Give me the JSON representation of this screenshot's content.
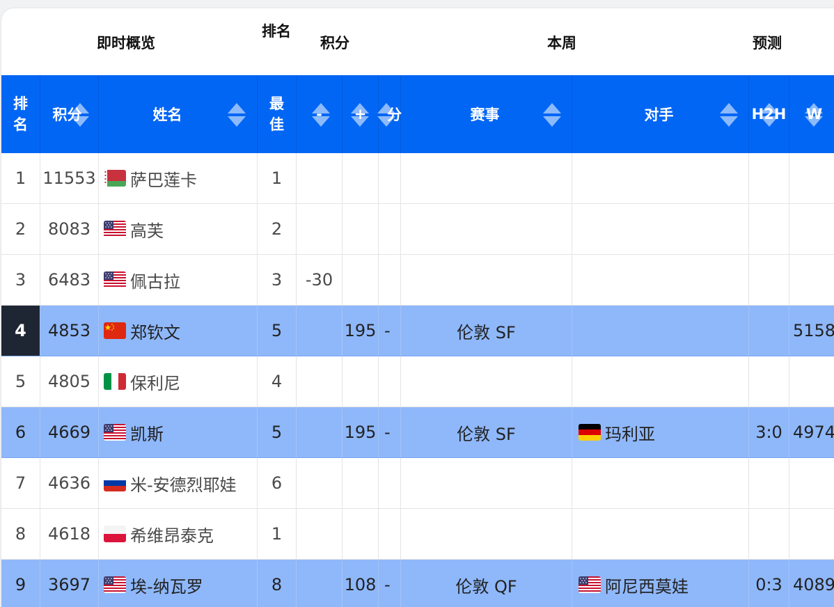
{
  "group_header": {
    "overview": "即时概览",
    "rank": "排名",
    "points": "积分",
    "this_week": "本周",
    "forecast": "预测"
  },
  "column_header": {
    "rank": "排名",
    "points": "积分",
    "name": "姓名",
    "best": "最佳",
    "minus": "-",
    "plus": "+",
    "pts": "分",
    "event": "赛事",
    "opponent": "对手",
    "h2h": "H2H",
    "w": "W"
  },
  "rows": [
    {
      "rank": "1",
      "points": "11553",
      "flag": "belarus-flag",
      "name": "萨巴莲卡",
      "best": "1",
      "minus": "",
      "plus": "",
      "pts": "",
      "event": "",
      "opp_flag": "",
      "opponent": "",
      "h2h": "",
      "w": "",
      "highlight": false
    },
    {
      "rank": "2",
      "points": "8083",
      "flag": "usa-flag",
      "name": "高芙",
      "best": "2",
      "minus": "",
      "plus": "",
      "pts": "",
      "event": "",
      "opp_flag": "",
      "opponent": "",
      "h2h": "",
      "w": "",
      "highlight": false
    },
    {
      "rank": "3",
      "points": "6483",
      "flag": "usa-flag",
      "name": "佩古拉",
      "best": "3",
      "minus": "-30",
      "plus": "",
      "pts": "",
      "event": "",
      "opp_flag": "",
      "opponent": "",
      "h2h": "",
      "w": "",
      "highlight": false
    },
    {
      "rank": "4",
      "points": "4853",
      "flag": "china-flag",
      "name": "郑钦文",
      "best": "5",
      "minus": "",
      "plus": "195",
      "pts": "-",
      "event": "伦敦 SF",
      "opp_flag": "",
      "opponent": "",
      "h2h": "",
      "w": "5158",
      "highlight": true,
      "current": true
    },
    {
      "rank": "5",
      "points": "4805",
      "flag": "italy-flag",
      "name": "保利尼",
      "best": "4",
      "minus": "",
      "plus": "",
      "pts": "",
      "event": "",
      "opp_flag": "",
      "opponent": "",
      "h2h": "",
      "w": "",
      "highlight": false
    },
    {
      "rank": "6",
      "points": "4669",
      "flag": "usa-flag",
      "name": "凯斯",
      "best": "5",
      "minus": "",
      "plus": "195",
      "pts": "-",
      "event": "伦敦 SF",
      "opp_flag": "germany-flag",
      "opponent": "玛利亚",
      "h2h": "3:0",
      "w": "4974",
      "highlight": true
    },
    {
      "rank": "7",
      "points": "4636",
      "flag": "russia-flag",
      "name": "米-安德烈耶娃",
      "best": "6",
      "minus": "",
      "plus": "",
      "pts": "",
      "event": "",
      "opp_flag": "",
      "opponent": "",
      "h2h": "",
      "w": "",
      "highlight": false
    },
    {
      "rank": "8",
      "points": "4618",
      "flag": "poland-flag",
      "name": "希维昂泰克",
      "best": "1",
      "minus": "",
      "plus": "",
      "pts": "",
      "event": "",
      "opp_flag": "",
      "opponent": "",
      "h2h": "",
      "w": "",
      "highlight": false
    },
    {
      "rank": "9",
      "points": "3697",
      "flag": "usa-flag",
      "name": "埃-纳瓦罗",
      "best": "8",
      "minus": "",
      "plus": "108",
      "pts": "-",
      "event": "伦敦 QF",
      "opp_flag": "usa-flag",
      "opponent": "阿尼西莫娃",
      "h2h": "0:3",
      "w": "4089",
      "highlight": true
    }
  ],
  "colors": {
    "header_blue": "#0266f5",
    "row_highlight": "#8fb8fb",
    "current_rank_bg": "#1f2633"
  }
}
